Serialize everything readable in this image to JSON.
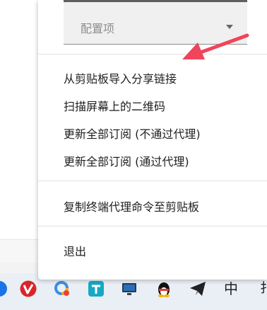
{
  "select": {
    "label": "配置项"
  },
  "menu": {
    "items": [
      {
        "label": "从剪贴板导入分享链接"
      },
      {
        "label": "扫描屏幕上的二维码"
      },
      {
        "label": "更新全部订阅 (不通过代理)"
      },
      {
        "label": "更新全部订阅 (通过代理)"
      },
      {
        "label": "复制终端代理命令至剪贴板"
      },
      {
        "label": "退出"
      }
    ]
  },
  "taskbar": {
    "ime_label": "中"
  },
  "colors": {
    "arrow": "#f0445c",
    "menu_bg": "#ffffff",
    "taskbar_bg": "#eaeff5"
  },
  "icons": [
    "blue-app-icon",
    "red-shield-app-icon",
    "colorful-circle-app-icon",
    "teal-cloud-app-icon",
    "monitor-app-icon",
    "qq-penguin-icon",
    "telegram-icon",
    "ime-chinese-indicator"
  ]
}
